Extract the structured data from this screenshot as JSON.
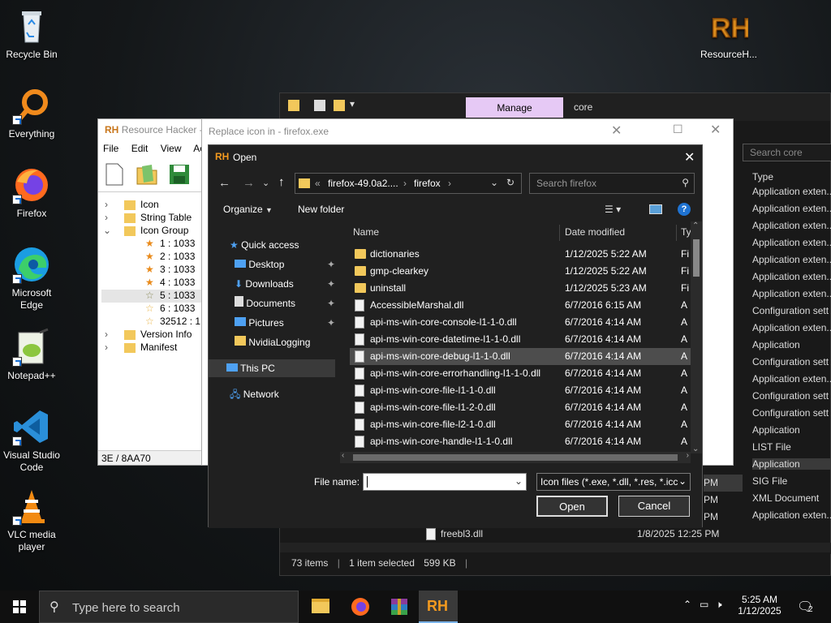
{
  "desktop": {
    "icons": [
      {
        "label": "Recycle Bin"
      },
      {
        "label": "Everything"
      },
      {
        "label": "Firefox"
      },
      {
        "label": "Microsoft Edge"
      },
      {
        "label": "Notepad++"
      },
      {
        "label": "Visual Studio Code"
      },
      {
        "label": "VLC media player"
      },
      {
        "label": "ResourceH..."
      }
    ]
  },
  "explorer_back": {
    "ribbon_tab": "Manage",
    "title": "core",
    "search_placeholder": "Search core",
    "type_header": "Type",
    "types": [
      "Application exten...",
      "Application exten...",
      "Application exten...",
      "Application exten...",
      "Application exten...",
      "Application exten...",
      "Application exten...",
      "Configuration sett",
      "Application exten...",
      "Application",
      "Configuration sett",
      "Application exten...",
      "Configuration sett",
      "Configuration sett",
      "Application",
      "LIST File",
      "Application",
      "SIG File",
      "XML Document",
      "Application exten..."
    ],
    "partial_times": [
      "PM",
      "PM",
      "PM"
    ],
    "visible_file": {
      "name": "freebl3.dll",
      "date": "1/8/2025 12:25 PM"
    },
    "status": {
      "items": "73 items",
      "selected": "1 item selected",
      "size": "599 KB"
    },
    "partial_number": "1033"
  },
  "resource_hacker": {
    "title": "Resource Hacker -",
    "menu": [
      "File",
      "Edit",
      "View",
      "Act"
    ],
    "tree": [
      {
        "label": "Icon",
        "indent": 0
      },
      {
        "label": "String Table",
        "indent": 0
      },
      {
        "label": "Icon Group",
        "indent": 0
      },
      {
        "label": "1 : 1033",
        "indent": 1
      },
      {
        "label": "2 : 1033",
        "indent": 1
      },
      {
        "label": "3 : 1033",
        "indent": 1
      },
      {
        "label": "4 : 1033",
        "indent": 1
      },
      {
        "label": "5 : 1033",
        "indent": 1
      },
      {
        "label": "6 : 1033",
        "indent": 1
      },
      {
        "label": "32512 : 1",
        "indent": 1
      },
      {
        "label": "Version Info",
        "indent": 0
      },
      {
        "label": "Manifest",
        "indent": 0
      }
    ],
    "status": "3E / 8AA70"
  },
  "replace_dialog": {
    "title": "Replace icon in - firefox.exe"
  },
  "open_dialog": {
    "title": "Open",
    "address": {
      "prefix": "«",
      "segment1": "firefox-49.0a2....",
      "segment2": "firefox"
    },
    "search_placeholder": "Search firefox",
    "organize": "Organize",
    "new_folder": "New folder",
    "nav": {
      "quick_access": "Quick access",
      "desktop": "Desktop",
      "downloads": "Downloads",
      "documents": "Documents",
      "pictures": "Pictures",
      "nvidia": "NvidiaLogging",
      "this_pc": "This PC",
      "network": "Network"
    },
    "columns": {
      "name": "Name",
      "date": "Date modified",
      "type": "Ty"
    },
    "files": [
      {
        "name": "dictionaries",
        "date": "1/12/2025 5:22 AM",
        "type": "Fi",
        "kind": "folder"
      },
      {
        "name": "gmp-clearkey",
        "date": "1/12/2025 5:22 AM",
        "type": "Fi",
        "kind": "folder"
      },
      {
        "name": "uninstall",
        "date": "1/12/2025 5:23 AM",
        "type": "Fi",
        "kind": "folder"
      },
      {
        "name": "AccessibleMarshal.dll",
        "date": "6/7/2016 6:15 AM",
        "type": "A",
        "kind": "file"
      },
      {
        "name": "api-ms-win-core-console-l1-1-0.dll",
        "date": "6/7/2016 4:14 AM",
        "type": "A",
        "kind": "file"
      },
      {
        "name": "api-ms-win-core-datetime-l1-1-0.dll",
        "date": "6/7/2016 4:14 AM",
        "type": "A",
        "kind": "file"
      },
      {
        "name": "api-ms-win-core-debug-l1-1-0.dll",
        "date": "6/7/2016 4:14 AM",
        "type": "A",
        "kind": "file"
      },
      {
        "name": "api-ms-win-core-errorhandling-l1-1-0.dll",
        "date": "6/7/2016 4:14 AM",
        "type": "A",
        "kind": "file"
      },
      {
        "name": "api-ms-win-core-file-l1-1-0.dll",
        "date": "6/7/2016 4:14 AM",
        "type": "A",
        "kind": "file"
      },
      {
        "name": "api-ms-win-core-file-l1-2-0.dll",
        "date": "6/7/2016 4:14 AM",
        "type": "A",
        "kind": "file"
      },
      {
        "name": "api-ms-win-core-file-l2-1-0.dll",
        "date": "6/7/2016 4:14 AM",
        "type": "A",
        "kind": "file"
      },
      {
        "name": "api-ms-win-core-handle-l1-1-0.dll",
        "date": "6/7/2016 4:14 AM",
        "type": "A",
        "kind": "file"
      }
    ],
    "file_name_label": "File name:",
    "file_name_value": "",
    "filter": "Icon files (*.exe, *.dll, *.res, *.icc",
    "open_button": "Open",
    "cancel_button": "Cancel"
  },
  "taskbar": {
    "search_placeholder": "Type here to search",
    "time": "5:25 AM",
    "date": "1/12/2025",
    "notifications": "2"
  }
}
